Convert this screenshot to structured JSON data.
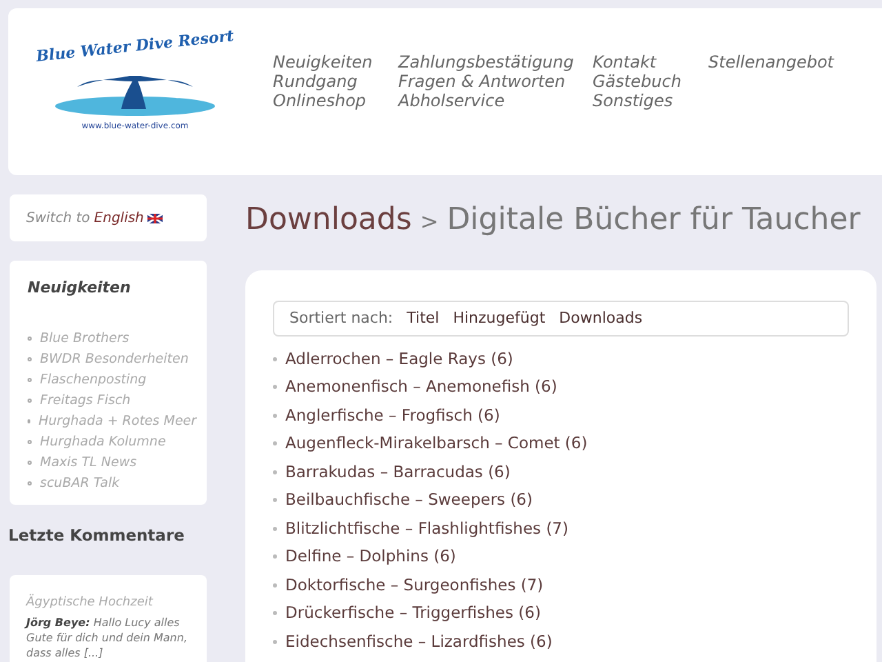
{
  "logo": {
    "title": "Blue Water Dive Resort",
    "url": "www.blue-water-dive.com"
  },
  "nav_columns": [
    [
      "Neuigkeiten",
      "Rundgang",
      "Onlineshop"
    ],
    [
      "Zahlungsbestätigung",
      "Fragen & Antworten",
      "Abholservice"
    ],
    [
      "Kontakt",
      "Gästebuch",
      "Sonstiges"
    ],
    [
      "Stellenangebot"
    ]
  ],
  "language_switch": {
    "prefix": "Switch to",
    "link": "English"
  },
  "news_widget": {
    "title": "Neuigkeiten",
    "items": [
      "Blue Brothers",
      "BWDR Besonderheiten",
      "Flaschenposting",
      "Freitags Fisch",
      "Hurghada + Rotes Meer",
      "Hurghada Kolumne",
      "Maxis TL News",
      "scuBAR Talk"
    ]
  },
  "comments_heading": "Letzte Kommentare",
  "comment": {
    "post": "Ägyptische Hochzeit",
    "author": "Jörg Beye:",
    "text": "Hallo Lucy alles Gute für dich und dein Mann, dass alles [...]"
  },
  "breadcrumb": {
    "parent": "Downloads",
    "separator": ">",
    "current": "Digitale Bücher für Taucher"
  },
  "sort_bar": {
    "label": "Sortiert nach:",
    "options": [
      "Titel",
      "Hinzugefügt",
      "Downloads"
    ]
  },
  "categories": [
    "Adlerrochen – Eagle Rays (6)",
    "Anemonenfisch – Anemonefish (6)",
    "Anglerfische – Frogfisch (6)",
    "Augenfleck-Mirakelbarsch – Comet (6)",
    "Barrakudas – Barracudas (6)",
    "Beilbauchfische – Sweepers (6)",
    "Blitzlichtfische – Flashlightfishes (7)",
    "Delfine – Dolphins (6)",
    "Doktorfische – Surgeonfishes (7)",
    "Drückerfische – Triggerfishes (6)",
    "Eidechsenfische – Lizardfishes (6)"
  ]
}
